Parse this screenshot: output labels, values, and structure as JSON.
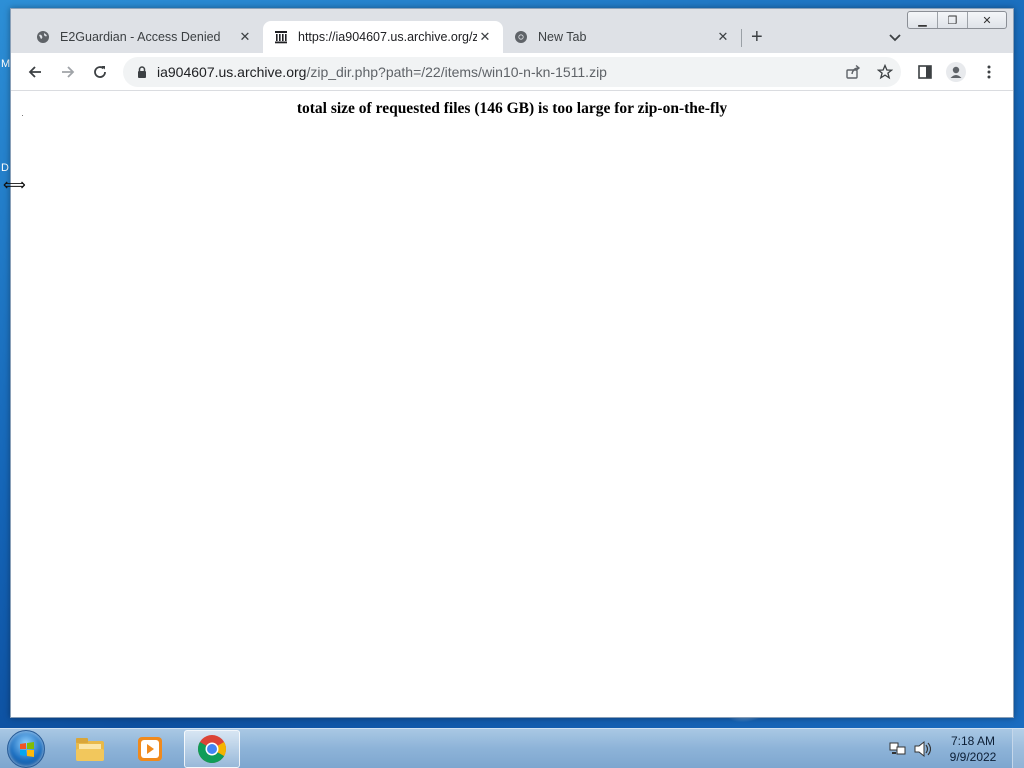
{
  "desktop": {
    "fragment_top": "M",
    "fragment_mid": "D"
  },
  "browser": {
    "tabs": [
      {
        "title": "E2Guardian - Access Denied",
        "icon": "globe-icon",
        "active": false
      },
      {
        "title": "https://ia904607.us.archive.org/zi",
        "icon": "archive-icon",
        "active": true
      },
      {
        "title": "New Tab",
        "icon": "chrome-icon",
        "active": false
      }
    ],
    "address": {
      "host": "ia904607.us.archive.org",
      "path": "/zip_dir.php?path=/22/items/win10-n-kn-1511.zip"
    }
  },
  "page": {
    "heading": "total size of requested files (146 GB) is too large for zip-on-the-fly"
  },
  "taskbar": {
    "time": "7:18 AM",
    "date": "9/9/2022",
    "apps": [
      "file-explorer-icon",
      "media-player-icon",
      "chrome-icon"
    ]
  },
  "colors": {
    "tab_strip": "#dee1e6",
    "omnibox": "#f1f3f4",
    "desktop": "#1e78c8"
  }
}
